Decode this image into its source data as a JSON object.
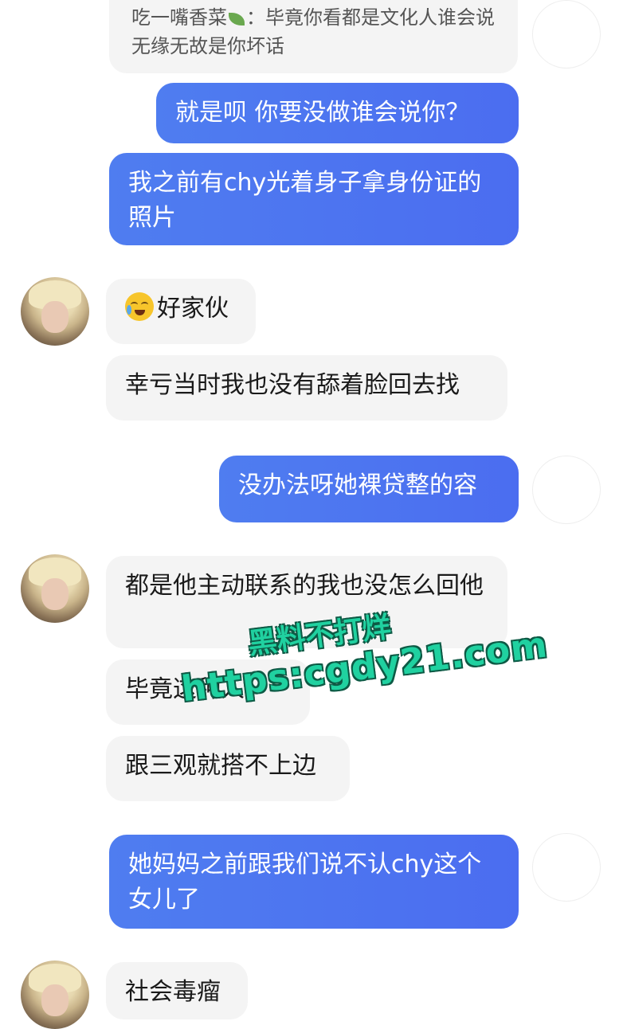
{
  "messages": {
    "quote": {
      "author": "吃一嘴香菜",
      "leaf_icon": "herb-leaf",
      "text_after_icon": "：毕竟你看都是文化人谁会说无缘无故是你坏话"
    },
    "m1": "就是呗  你要没做谁会说你？",
    "m2": "我之前有chy光着身子拿身份证的照片",
    "m3_emoji": "loudly-crying-face",
    "m3": "好家伙",
    "m4": "幸亏当时我也没有舔着脸回去找",
    "m5": "没办法呀她裸贷整的容",
    "m6": "都是他主动联系的我也没怎么回他",
    "m7": "毕竟这种人",
    "m8": "跟三观就搭不上边",
    "m9": "她妈妈之前跟我们说不认chy这个女儿了",
    "m10": "社会毒瘤"
  },
  "watermark": {
    "line1": "黑料不打烊",
    "line2": "https:cgdy21.com"
  },
  "colors": {
    "outgoing_bubble": "#4b6df0",
    "incoming_bubble": "#f4f4f4",
    "watermark": "#20d1a0"
  }
}
